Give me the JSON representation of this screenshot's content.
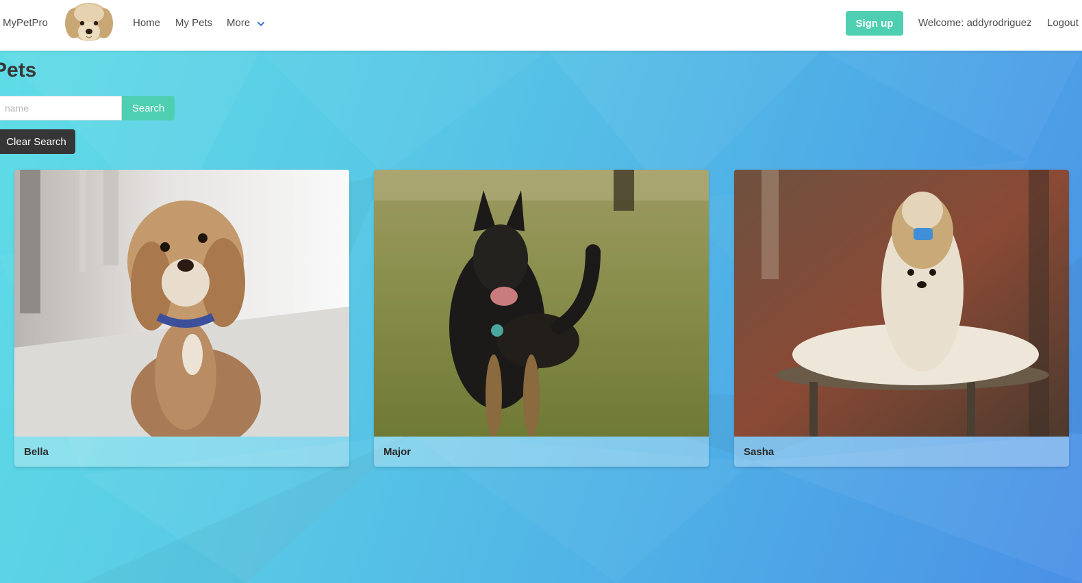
{
  "navbar": {
    "brand": "MyPetPro",
    "links": {
      "home": "Home",
      "my_pets": "My Pets",
      "more": "More"
    },
    "signup_label": "Sign up",
    "welcome_text": "Welcome: addyrodriguez",
    "logout_label": "Logout"
  },
  "page": {
    "title": "Pets",
    "search": {
      "placeholder": "name",
      "value": "",
      "button_label": "Search"
    },
    "clear_search_label": "Clear Search"
  },
  "pets": [
    {
      "name": "Bella"
    },
    {
      "name": "Major"
    },
    {
      "name": "Sasha"
    }
  ],
  "colors": {
    "accent": "#4fcfb1",
    "dark_button": "#363636",
    "background_start": "#5fdde6",
    "background_end": "#4a90e6"
  },
  "icons": {
    "more_dropdown": "chevron-down-icon"
  }
}
